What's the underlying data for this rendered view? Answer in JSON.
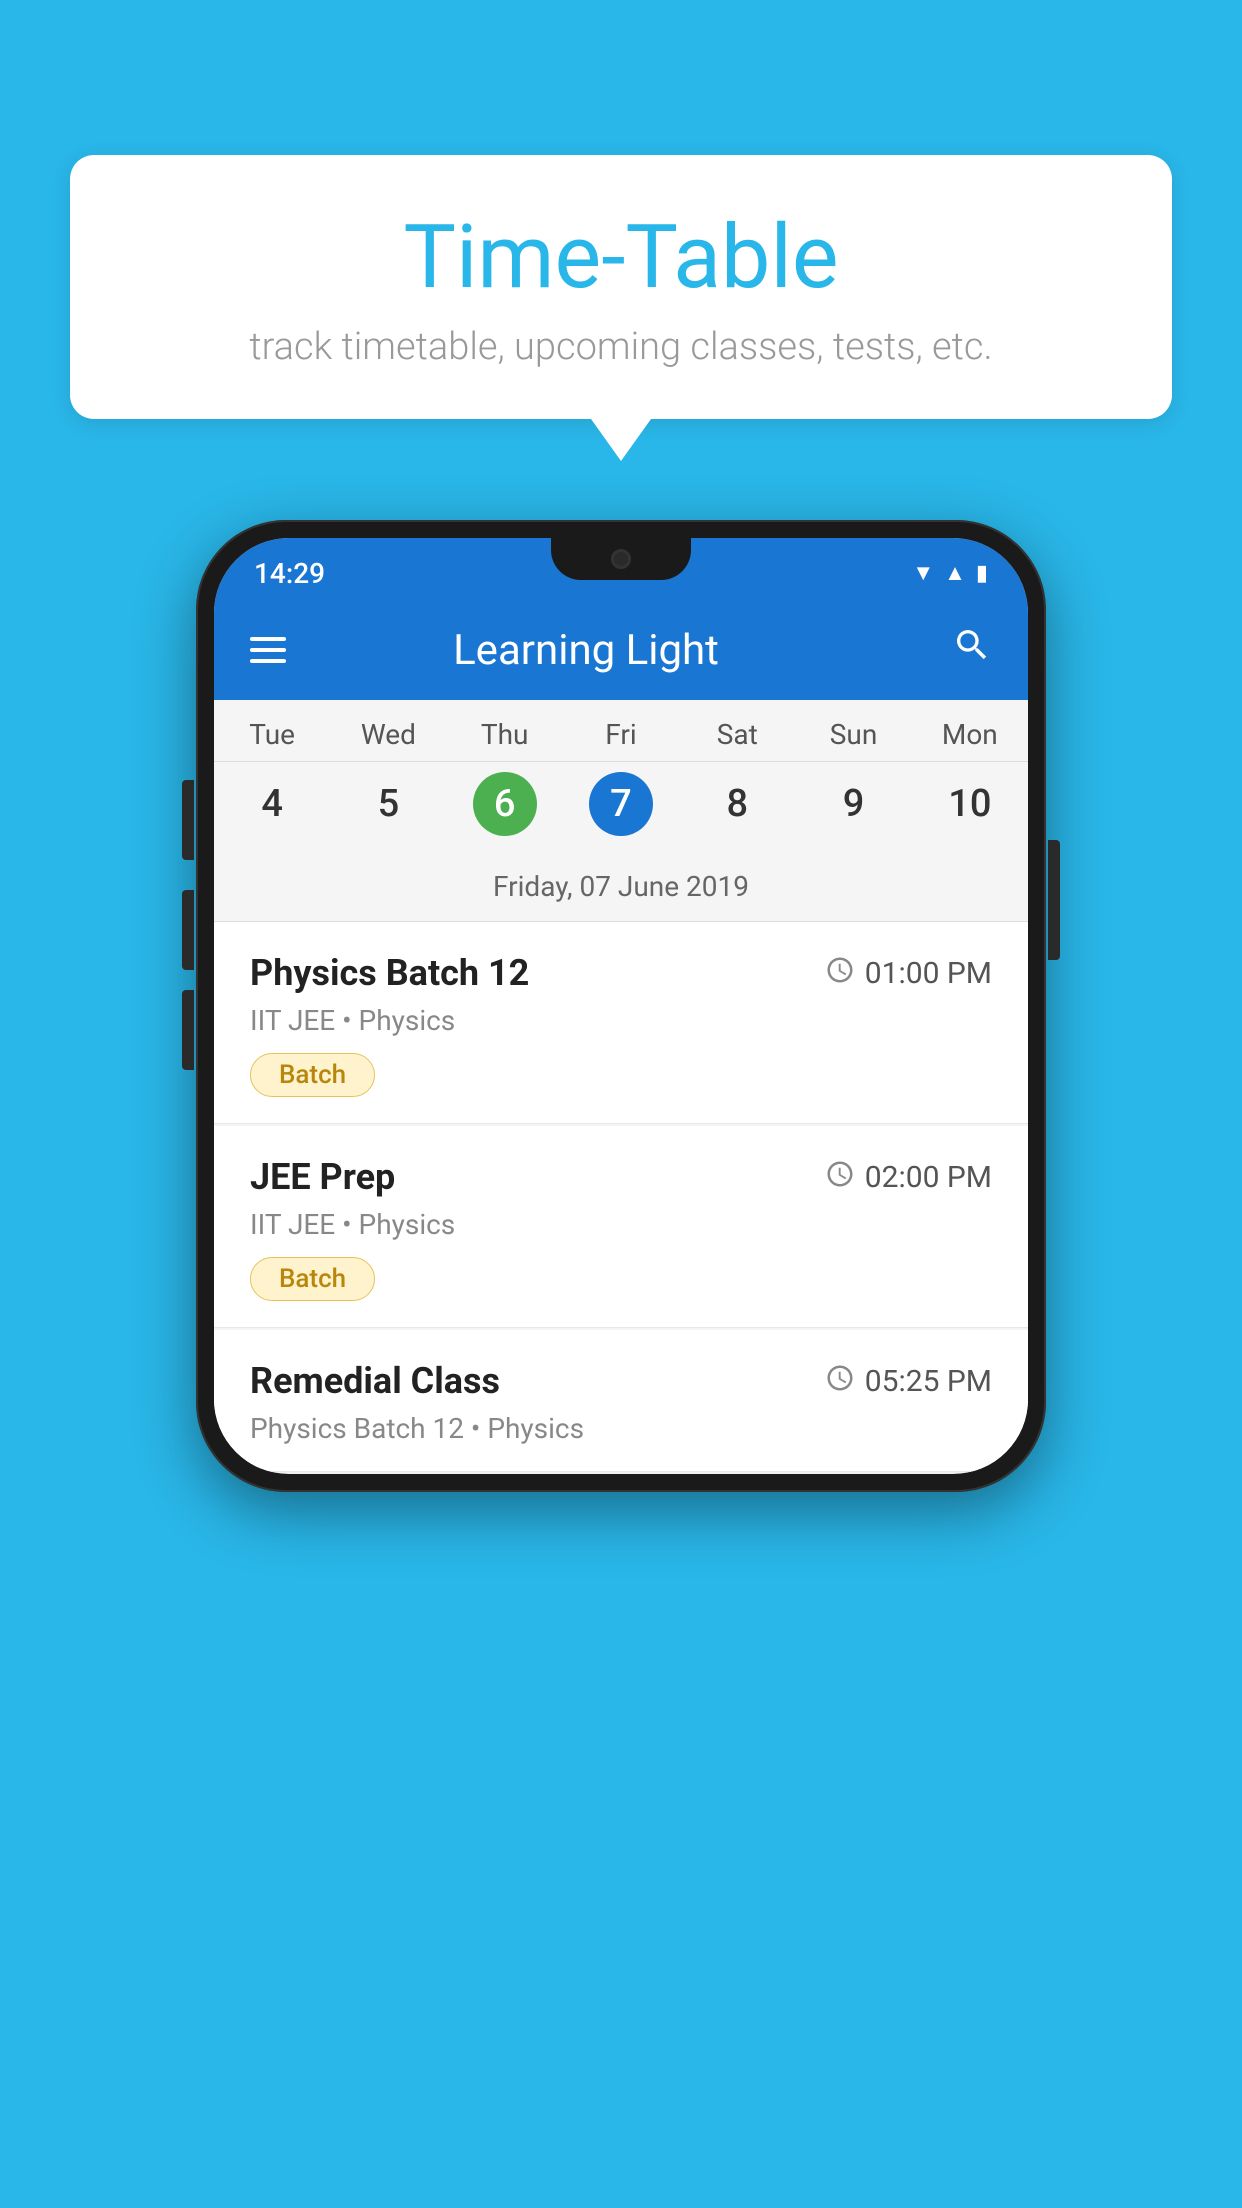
{
  "tooltip": {
    "title": "Time-Table",
    "subtitle": "track timetable, upcoming classes, tests, etc."
  },
  "phone": {
    "status_bar": {
      "time": "14:29",
      "signal_icon": "▲",
      "wifi_icon": "▼",
      "battery_icon": "▮"
    },
    "app_bar": {
      "title": "Learning Light",
      "hamburger_icon": "menu",
      "search_icon": "search"
    },
    "calendar": {
      "days": [
        "Tue",
        "Wed",
        "Thu",
        "Fri",
        "Sat",
        "Sun",
        "Mon"
      ],
      "dates": [
        "4",
        "5",
        "6",
        "7",
        "8",
        "9",
        "10"
      ],
      "today_index": 2,
      "selected_index": 3,
      "selected_date_label": "Friday, 07 June 2019"
    },
    "schedule_items": [
      {
        "title": "Physics Batch 12",
        "time": "01:00 PM",
        "subtitle": "IIT JEE • Physics",
        "badge": "Batch"
      },
      {
        "title": "JEE Prep",
        "time": "02:00 PM",
        "subtitle": "IIT JEE • Physics",
        "badge": "Batch"
      },
      {
        "title": "Remedial Class",
        "time": "05:25 PM",
        "subtitle": "Physics Batch 12 • Physics",
        "badge": null
      }
    ]
  }
}
